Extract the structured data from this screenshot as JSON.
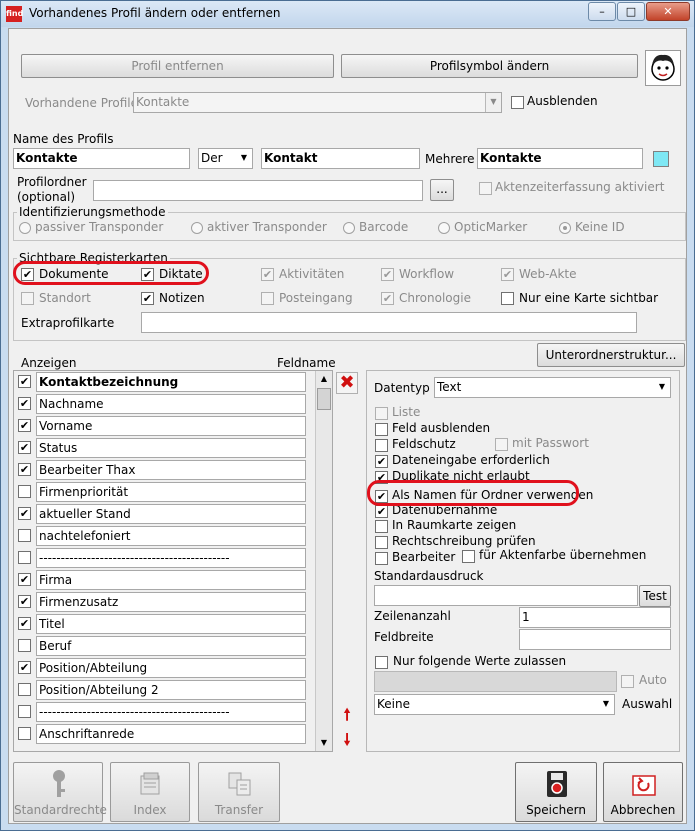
{
  "window": {
    "title": "Vorhandenes Profil ändern oder entfernen",
    "app_icon_text": "find"
  },
  "top": {
    "remove_profile": "Profil entfernen",
    "change_symbol": "Profilsymbol ändern",
    "existing_profiles_label": "Vorhandene Profile",
    "existing_profiles_value": "Kontakte",
    "hide_label": "Ausblenden"
  },
  "name": {
    "section_label": "Name des Profils",
    "singular": "Kontakte",
    "article": "Der",
    "singular2": "Kontakt",
    "plural_label": "Mehrere",
    "plural": "Kontakte"
  },
  "folder": {
    "label_line1": "Profilordner",
    "label_line2": "(optional)",
    "value": "",
    "browse": "...",
    "time_tracking": "Aktenzeiterfassung aktiviert"
  },
  "identification": {
    "legend": "Identifizierungsmethode",
    "options": [
      "passiver Transponder",
      "aktiver Transponder",
      "Barcode",
      "OpticMarker",
      "Keine ID"
    ],
    "selected": "Keine ID"
  },
  "tabs": {
    "legend": "Sichtbare Registerkarten",
    "items": [
      {
        "label": "Dokumente",
        "checked": true,
        "enabled": true
      },
      {
        "label": "Diktate",
        "checked": true,
        "enabled": true
      },
      {
        "label": "Aktivitäten",
        "checked": true,
        "enabled": false
      },
      {
        "label": "Workflow",
        "checked": true,
        "enabled": false
      },
      {
        "label": "Web-Akte",
        "checked": true,
        "enabled": false
      },
      {
        "label": "Standort",
        "checked": false,
        "enabled": false
      },
      {
        "label": "Notizen",
        "checked": true,
        "enabled": true
      },
      {
        "label": "Posteingang",
        "checked": false,
        "enabled": false
      },
      {
        "label": "Chronologie",
        "checked": true,
        "enabled": false
      },
      {
        "label": "Nur eine Karte sichtbar",
        "checked": false,
        "enabled": true
      }
    ],
    "extra_label": "Extraprofilkarte",
    "extra_value": ""
  },
  "fields": {
    "col_show": "Anzeigen",
    "col_name": "Feldname",
    "subfolder_button": "Unterordnerstruktur...",
    "rows": [
      {
        "name": "Kontaktbezeichnung",
        "checked": true,
        "bold": true
      },
      {
        "name": "Nachname",
        "checked": true
      },
      {
        "name": "Vorname",
        "checked": true
      },
      {
        "name": "Status",
        "checked": true
      },
      {
        "name": "Bearbeiter Thax",
        "checked": true
      },
      {
        "name": "Firmenpriorität",
        "checked": false
      },
      {
        "name": "aktueller Stand",
        "checked": true
      },
      {
        "name": "nachtelefoniert",
        "checked": false
      },
      {
        "name": "--------------------------------------------",
        "checked": false
      },
      {
        "name": "Firma",
        "checked": true
      },
      {
        "name": "Firmenzusatz",
        "checked": true
      },
      {
        "name": "Titel",
        "checked": true
      },
      {
        "name": "Beruf",
        "checked": false
      },
      {
        "name": "Position/Abteilung",
        "checked": true
      },
      {
        "name": "Position/Abteilung 2",
        "checked": false
      },
      {
        "name": "--------------------------------------------",
        "checked": false
      },
      {
        "name": "Anschriftanrede",
        "checked": false
      }
    ]
  },
  "props": {
    "datatype_label": "Datentyp",
    "datatype_value": "Text",
    "options": [
      {
        "label": "Liste",
        "checked": false,
        "enabled": false
      },
      {
        "label": "Feld ausblenden",
        "checked": false,
        "enabled": true
      },
      {
        "label": "Feldschutz",
        "checked": false,
        "enabled": true
      },
      {
        "label": "Dateneingabe erforderlich",
        "checked": true,
        "enabled": true
      },
      {
        "label": "Duplikate nicht erlaubt",
        "checked": true,
        "enabled": true
      },
      {
        "label": "Als Namen für  Ordner verwenden",
        "checked": true,
        "enabled": true
      },
      {
        "label": "Datenübernahme",
        "checked": true,
        "enabled": true
      },
      {
        "label": "In Raumkarte zeigen",
        "checked": false,
        "enabled": true
      },
      {
        "label": "Rechtschreibung prüfen",
        "checked": false,
        "enabled": true
      },
      {
        "label": "Bearbeiter",
        "checked": false,
        "enabled": true
      }
    ],
    "with_password": "mit Passwort",
    "for_file_color": "für Aktenfarbe übernehmen",
    "standard_print_label": "Standardausdruck",
    "standard_print_value": "",
    "test_button": "Test",
    "lines_label": "Zeilenanzahl",
    "lines_value": "1",
    "width_label": "Feldbreite",
    "width_value": "",
    "only_values": "Nur folgende Werte zulassen",
    "auto_label": "Auto",
    "selection_value": "Keine",
    "selection_label": "Auswahl"
  },
  "bottom": {
    "rights": "Standardrechte",
    "index": "Index",
    "transfer": "Transfer",
    "save": "Speichern",
    "cancel": "Abbrechen"
  },
  "colors": {
    "highlight": "#e0101c",
    "swatch": "#7fe8f4"
  }
}
